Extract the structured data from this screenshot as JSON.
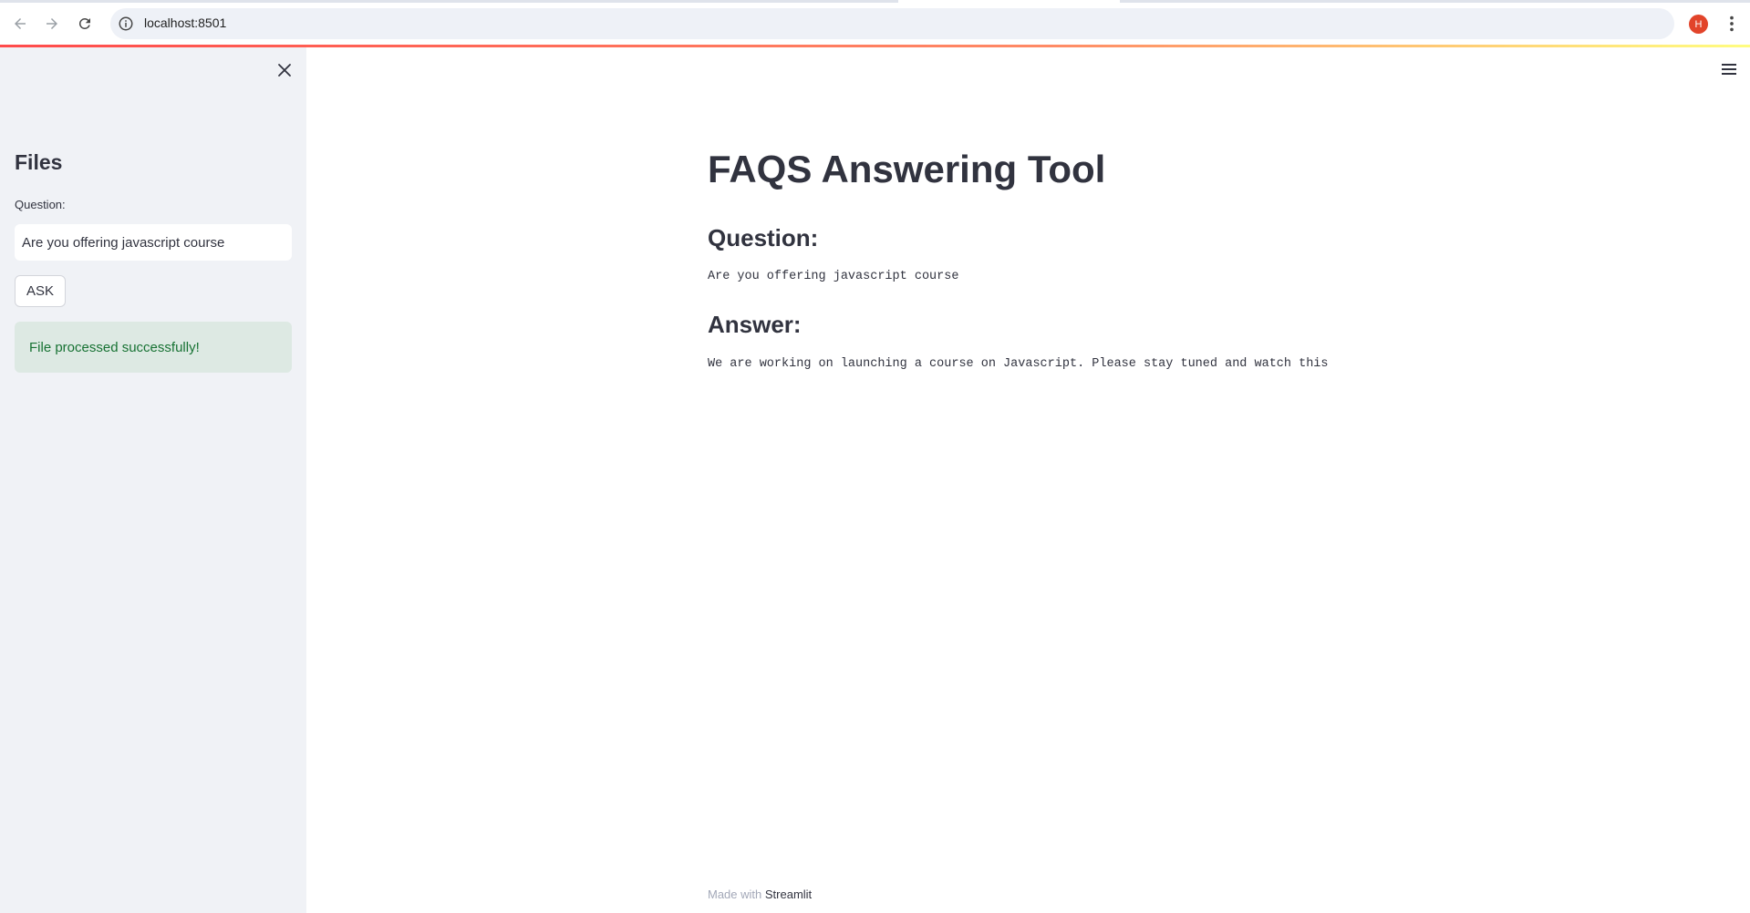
{
  "browser": {
    "url": "localhost:8501",
    "profile_initial": "H",
    "icons": {
      "back": "arrow-left-icon",
      "forward": "arrow-right-icon",
      "reload": "reload-icon",
      "site_info": "info-icon",
      "bookmark": "star-icon",
      "menu": "kebab-menu-icon"
    }
  },
  "sidebar": {
    "title": "Files",
    "question_label": "Question:",
    "question_value": "Are you offering javascript course",
    "ask_label": "ASK",
    "status_message": "File processed successfully!"
  },
  "main": {
    "title": "FAQS Answering Tool",
    "question_heading": "Question:",
    "question_text": "Are you offering javascript course",
    "answer_heading": "Answer:",
    "answer_text": "We are working on launching a course on Javascript. Please stay tuned and watch this"
  },
  "footer": {
    "made_with": "Made with",
    "link": "Streamlit"
  },
  "colors": {
    "sidebar_bg": "#f0f2f6",
    "success_bg": "#dde9e3",
    "success_text": "#177233",
    "text": "#31333f",
    "avatar": "#e2442a"
  }
}
